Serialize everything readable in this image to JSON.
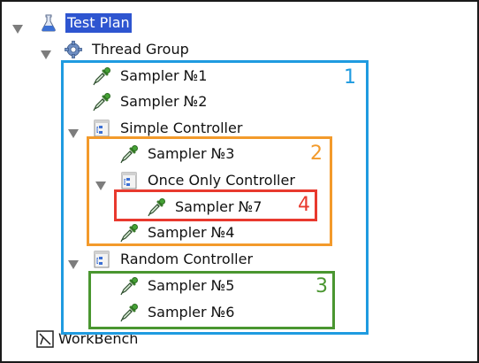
{
  "colors": {
    "selection_bg": "#2e55d0",
    "box_1": "#1f9be0",
    "box_2": "#f39a2b",
    "box_3": "#4a9630",
    "box_4": "#e8392e"
  },
  "tree": {
    "test_plan": {
      "label": "Test Plan",
      "icon": "flask-icon"
    },
    "thread_group": {
      "label": "Thread Group",
      "icon": "gear-icon"
    },
    "sampler_1": {
      "label": "Sampler №1",
      "icon": "pipette-icon"
    },
    "sampler_2": {
      "label": "Sampler №2",
      "icon": "pipette-icon"
    },
    "simple_controller": {
      "label": "Simple Controller",
      "icon": "controller-icon"
    },
    "sampler_3": {
      "label": "Sampler №3",
      "icon": "pipette-icon"
    },
    "once_only_controller": {
      "label": "Once Only Controller",
      "icon": "controller-icon"
    },
    "sampler_7": {
      "label": "Sampler №7",
      "icon": "pipette-icon"
    },
    "sampler_4": {
      "label": "Sampler №4",
      "icon": "pipette-icon"
    },
    "random_controller": {
      "label": "Random Controller",
      "icon": "controller-icon"
    },
    "sampler_5": {
      "label": "Sampler №5",
      "icon": "pipette-icon"
    },
    "sampler_6": {
      "label": "Sampler №6",
      "icon": "pipette-icon"
    },
    "workbench": {
      "label": "WorkBench",
      "icon": "workbench-icon"
    }
  },
  "annotations": {
    "box_1": "1",
    "box_2": "2",
    "box_3": "3",
    "box_4": "4"
  }
}
